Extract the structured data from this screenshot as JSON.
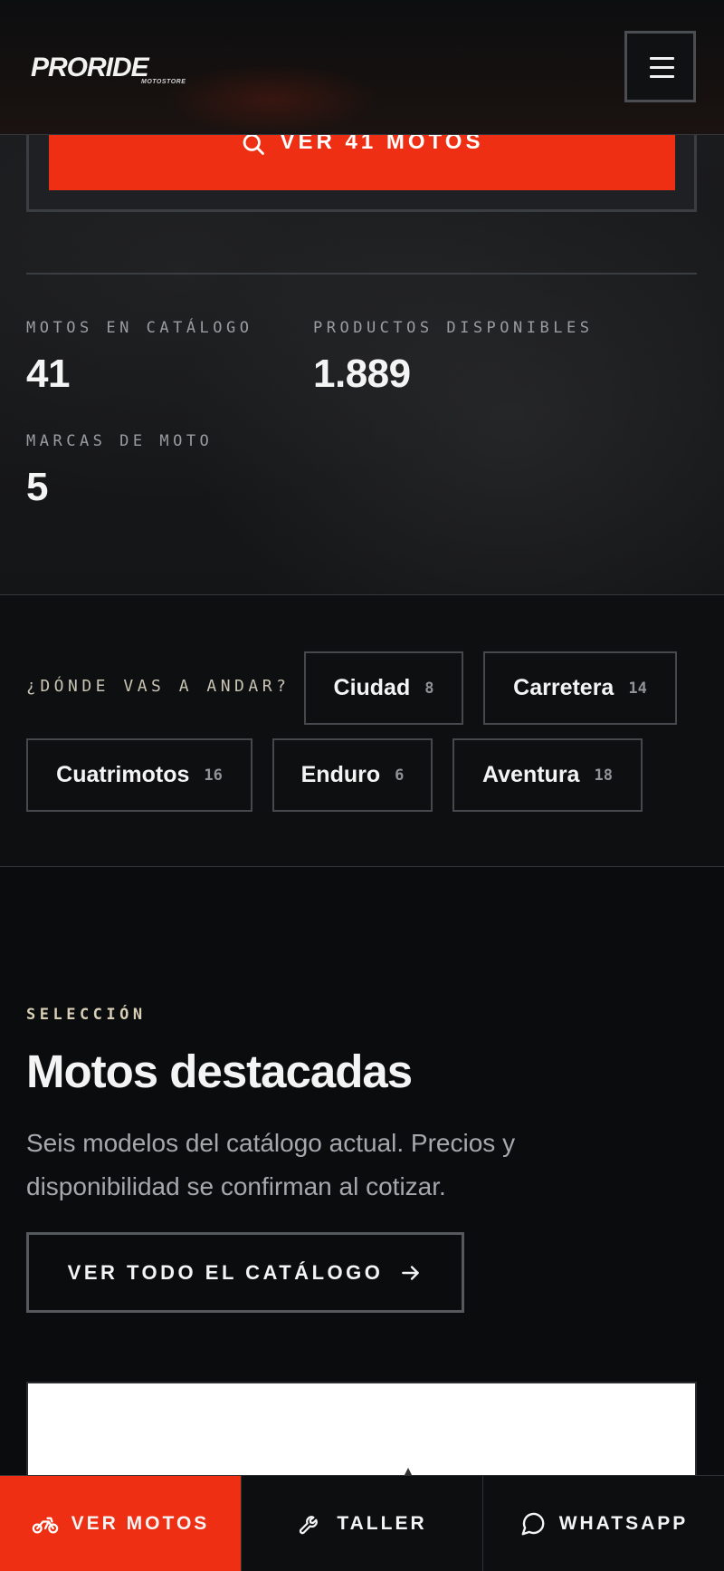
{
  "header": {
    "logo_text": "PRORIDE",
    "logo_subtext": "MOTOSTORE",
    "menu_icon": "hamburger-menu-icon"
  },
  "hero": {
    "cta_label": "VER 41 MOTOS",
    "cta_icon": "search-icon",
    "stats": [
      {
        "label": "MOTOS EN CATÁLOGO",
        "value": "41"
      },
      {
        "label": "PRODUCTOS DISPONIBLES",
        "value": "1.889"
      },
      {
        "label": "MARCAS DE MOTO",
        "value": "5"
      }
    ]
  },
  "terrain": {
    "label": "¿DÓNDE VAS A ANDAR?",
    "chips": [
      {
        "name": "Ciudad",
        "count": "8"
      },
      {
        "name": "Carretera",
        "count": "14"
      },
      {
        "name": "Cuatrimotos",
        "count": "16"
      },
      {
        "name": "Enduro",
        "count": "6"
      },
      {
        "name": "Aventura",
        "count": "18"
      }
    ]
  },
  "featured": {
    "eyebrow": "SELECCIÓN",
    "title": "Motos destacadas",
    "description": "Seis modelos del catálogo actual. Precios y disponibilidad se confirman al cotizar.",
    "button_label": "VER TODO EL CATÁLOGO",
    "button_icon": "arrow-right-icon"
  },
  "bottom_bar": {
    "items": [
      {
        "label": "VER MOTOS",
        "icon": "motorcycle-icon"
      },
      {
        "label": "TALLER",
        "icon": "wrench-icon"
      },
      {
        "label": "WHATSAPP",
        "icon": "chat-bubble-icon"
      }
    ]
  },
  "colors": {
    "accent": "#ee2f13",
    "background": "#0b0c0e",
    "border": "#45484d"
  }
}
